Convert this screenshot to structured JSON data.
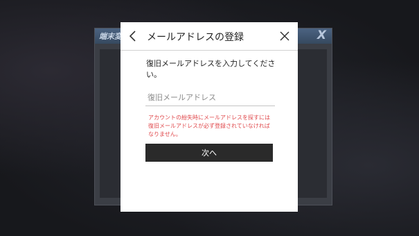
{
  "background": {
    "window_title": "端末変更",
    "close_glyph": "X"
  },
  "dialog": {
    "title": "メールアドレスの登録",
    "back_icon": "chevron-left-icon",
    "close_icon": "close-icon",
    "instruction": "復旧メールアドレスを入力してください。",
    "email_input": {
      "placeholder": "復旧メールアドレス",
      "value": ""
    },
    "warning": "アカウントの紛失時にメールアドレスを探すには復旧メールアドレスが必ず登録されていなければなりません。",
    "next_label": "次へ"
  },
  "colors": {
    "warning_text": "#e0494c",
    "button_bg": "#2a2a2a",
    "dialog_bg": "#ffffff",
    "backdrop": "#1b1c21"
  }
}
